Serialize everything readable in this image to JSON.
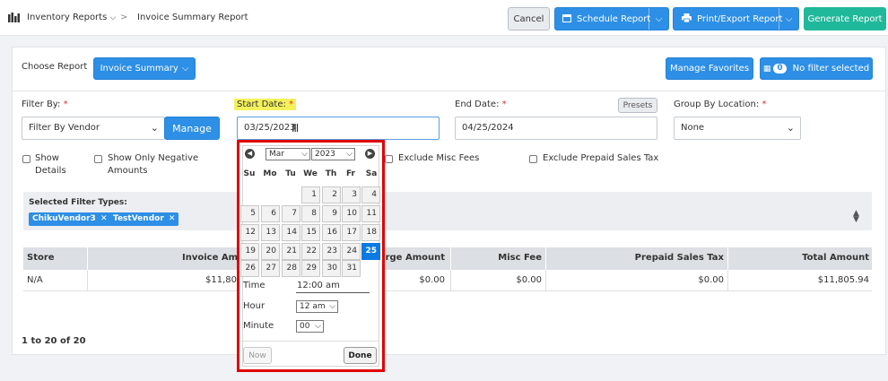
{
  "breadcrumb": {
    "parent": "Inventory Reports",
    "current": "Invoice Summary Report"
  },
  "header_buttons": {
    "cancel": "Cancel",
    "schedule": "Schedule Report",
    "print": "Print/Export Report",
    "generate": "Generate Report"
  },
  "report": {
    "choose_label": "Choose Report",
    "selected": "Invoice Summary"
  },
  "actions": {
    "favorites": "Manage Favorites",
    "filter_count": "0",
    "filter_label": "No filter selected"
  },
  "filters": {
    "filter_by_label": "Filter By:",
    "filter_by_value": "Filter By Vendor",
    "manage": "Manage",
    "start_label": "Start Date:",
    "start_value": "03/25/2023",
    "end_label": "End Date:",
    "end_value": "04/25/2024",
    "presets": "Presets",
    "group_label": "Group By Location:",
    "group_value": "None",
    "req": "*"
  },
  "checkboxes": {
    "show_details_1": "Show",
    "show_details_2": "Details",
    "negative_1": "Show Only Negative",
    "negative_2": "Amounts",
    "misc": "Exclude Misc Fees",
    "prepaid": "Exclude Prepaid Sales Tax"
  },
  "selected_filters": {
    "title": "Selected Filter Types:",
    "tags": [
      "ChikuVendor3",
      "TestVendor"
    ]
  },
  "table": {
    "headers": [
      "Store",
      "Invoice Amount",
      "Charge Amount",
      "Misc Fee",
      "Prepaid Sales Tax",
      "Total Amount"
    ],
    "row": {
      "store": "N/A",
      "invoice": "$11,805.94",
      "charge": "$0.00",
      "misc": "$0.00",
      "prepaid": "$0.00",
      "total": "$11,805.94"
    },
    "pagination": "1 to 20 of 20"
  },
  "calendar": {
    "month": "Mar",
    "year": "2023",
    "days_of_week": [
      "Su",
      "Mo",
      "Tu",
      "We",
      "Th",
      "Fr",
      "Sa"
    ],
    "selected_day": 25,
    "time_label": "Time",
    "time_value": "12:00 am",
    "hour_label": "Hour",
    "hour_value": "12 am",
    "minute_label": "Minute",
    "minute_value": "00",
    "now": "Now",
    "done": "Done"
  },
  "colors": {
    "accent": "#2d8fe6",
    "teal": "#1fb89a",
    "highlight": "#e00000"
  }
}
